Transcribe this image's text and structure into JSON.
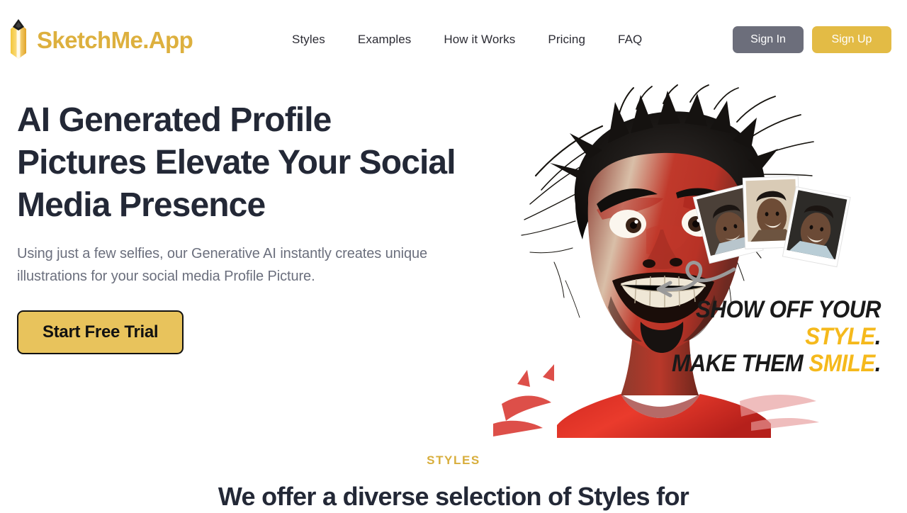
{
  "header": {
    "brand_name": "SketchMe.App",
    "logo_icon": "pencil-icon",
    "nav": [
      {
        "label": "Styles"
      },
      {
        "label": "Examples"
      },
      {
        "label": "How it Works"
      },
      {
        "label": "Pricing"
      },
      {
        "label": "FAQ"
      }
    ],
    "sign_in_label": "Sign In",
    "sign_up_label": "Sign Up",
    "colors": {
      "brand_gold": "#ddb03e",
      "sign_in_bg": "#6c6e7b",
      "sign_up_bg": "#e3bb45",
      "nav_text": "#2b2b33"
    }
  },
  "hero": {
    "title": "AI Generated Profile Pictures Elevate Your Social Media Presence",
    "subtitle": "Using just a few selfies, our Generative AI instantly creates unique illustrations for your social media Profile Picture.",
    "cta_label": "Start Free Trial",
    "cta_colors": {
      "bg": "#e8c35c",
      "border": "#111111",
      "text": "#111111"
    },
    "illustration": {
      "name": "ai-caricature-illustration",
      "description": "Caricature portrait of a man with wild hair, red-toned face, grimacing, wearing a red t-shirt",
      "photos_label": "source-selfie-photos",
      "photo_count": 3,
      "arrow_icon": "curved-arrow-left-icon"
    },
    "tagline": {
      "line1_plain": "SHOW OFF YOUR ",
      "line1_highlight": "STYLE",
      "line2_plain": "MAKE THEM ",
      "line2_highlight": "SMILE",
      "period": ".",
      "highlight_color": "#f5b91c",
      "text_color": "#1a1a1a"
    }
  },
  "styles_section": {
    "eyebrow": "STYLES",
    "heading": "We offer a diverse selection of Styles for",
    "eyebrow_color": "#d8ae3c"
  }
}
